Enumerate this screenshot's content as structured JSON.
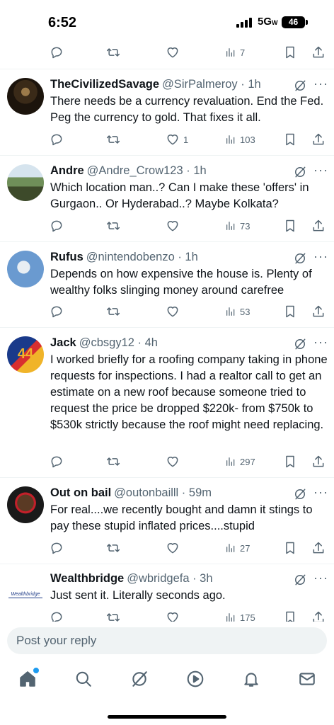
{
  "status_bar": {
    "time": "6:52",
    "network": "5G",
    "battery": "46"
  },
  "top_partial_actions": {
    "views": "7"
  },
  "tweets": [
    {
      "name": "TheCivilizedSavage",
      "handle": "@SirPalmeroy · 1h",
      "text": "There needs be a currency revaluation. End the Fed. Peg the currency to gold. That fixes it all.",
      "replies": "",
      "retweets": "",
      "likes": "1",
      "views": "103"
    },
    {
      "name": "Andre",
      "handle": "@Andre_Crow123 · 1h",
      "text": "Which location man..? Can I make these 'offers' in Gurgaon.. Or Hyderabad..? Maybe Kolkata?",
      "replies": "",
      "retweets": "",
      "likes": "",
      "views": "73"
    },
    {
      "name": "Rufus",
      "handle": "@nintendobenzo · 1h",
      "text": "Depends on how expensive the house is. Plenty of wealthy folks slinging money around carefree",
      "replies": "",
      "retweets": "",
      "likes": "",
      "views": "53"
    },
    {
      "name": "Jack",
      "handle": "@cbsgy12 · 4h",
      "text": "I worked briefly for a roofing company taking in phone requests for inspections. I had a realtor call to get an estimate on a new roof because someone tried to request the price be dropped $220k- from $750k to $530k strictly because the roof might need replacing.",
      "replies": "",
      "retweets": "",
      "likes": "",
      "views": "297"
    },
    {
      "name": "Out on bail",
      "handle": "@outonbailll · 59m",
      "text": "For real....we recently bought and damn it stings to pay these stupid inflated prices....stupid",
      "replies": "",
      "retweets": "",
      "likes": "",
      "views": "27"
    },
    {
      "name": "Wealthbridge",
      "handle": "@wbridgefa · 3h",
      "text": "Just sent it. Literally seconds ago.",
      "replies": "",
      "retweets": "",
      "likes": "",
      "views": "175"
    }
  ],
  "wealthbridge_logo_text": "Wealthbridge",
  "reply": {
    "placeholder": "Post your reply"
  },
  "nav": [
    "home-icon",
    "search-icon",
    "grok-icon",
    "video-icon",
    "notifications-icon",
    "messages-icon"
  ],
  "colors": {
    "accent": "#1d9bf0",
    "muted": "#536471",
    "text": "#0f1419"
  }
}
